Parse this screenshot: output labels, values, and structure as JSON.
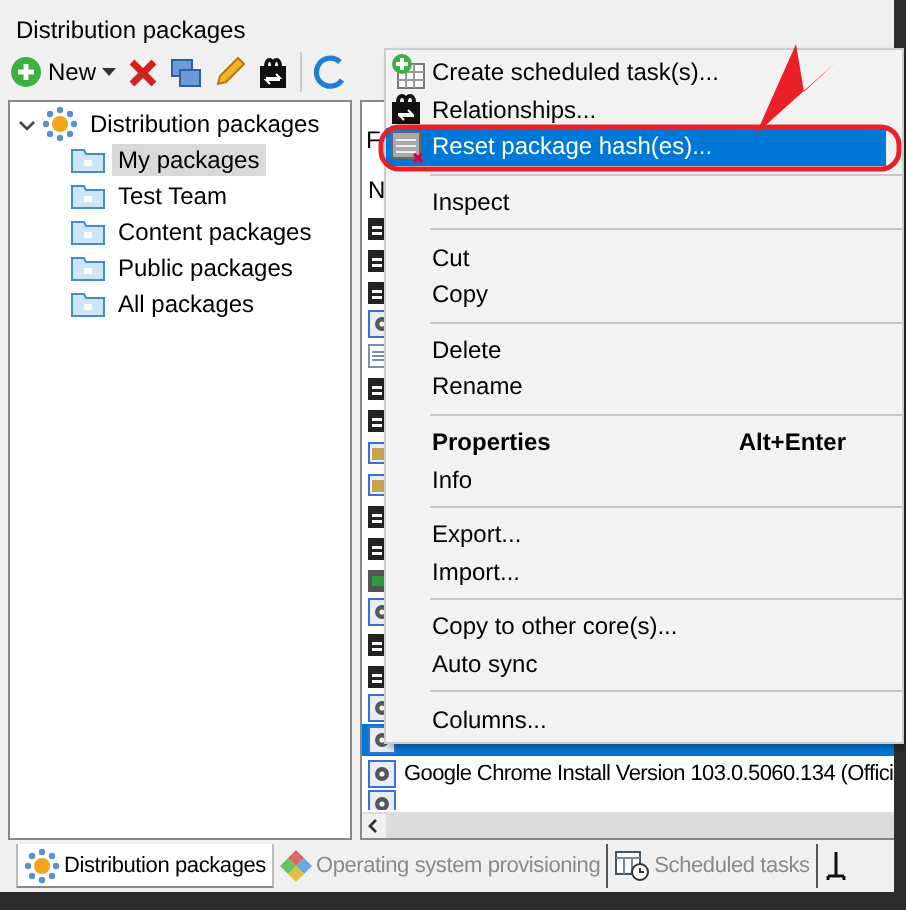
{
  "window": {
    "title": "Distribution packages"
  },
  "toolbar": {
    "new_button": {
      "label": "New"
    }
  },
  "tree": {
    "label": "Distribution packages",
    "expanded": true,
    "children": [
      {
        "label": "My packages",
        "selected": true
      },
      {
        "label": "Test Team",
        "selected": false
      },
      {
        "label": "Content packages",
        "selected": false
      },
      {
        "label": "Public packages",
        "selected": false
      },
      {
        "label": "All packages",
        "selected": false
      }
    ]
  },
  "list": {
    "filter_label": "F",
    "column_1": "N",
    "rows": [
      {
        "name": "Google Chrome Install Version 103.0.5060.134 (Offici",
        "selected": false
      }
    ]
  },
  "context_menu": {
    "items": [
      {
        "kind": "item",
        "label": "Create scheduled task(s)...",
        "selected": false,
        "bold": false
      },
      {
        "kind": "item",
        "label": "Relationships...",
        "selected": false,
        "bold": false
      },
      {
        "kind": "item",
        "label": "Reset package hash(es)...",
        "selected": true,
        "bold": false
      },
      {
        "kind": "separator"
      },
      {
        "kind": "item",
        "label": "Inspect",
        "selected": false,
        "bold": false
      },
      {
        "kind": "separator"
      },
      {
        "kind": "item",
        "label": "Cut",
        "selected": false,
        "bold": false
      },
      {
        "kind": "item",
        "label": "Copy",
        "selected": false,
        "bold": false
      },
      {
        "kind": "separator"
      },
      {
        "kind": "item",
        "label": "Delete",
        "selected": false,
        "bold": false
      },
      {
        "kind": "item",
        "label": "Rename",
        "selected": false,
        "bold": false
      },
      {
        "kind": "separator"
      },
      {
        "kind": "item",
        "label": "Properties",
        "shortcut": "Alt+Enter",
        "selected": false,
        "bold": true
      },
      {
        "kind": "item",
        "label": "Info",
        "selected": false,
        "bold": false
      },
      {
        "kind": "separator"
      },
      {
        "kind": "item",
        "label": "Export...",
        "selected": false,
        "bold": false
      },
      {
        "kind": "item",
        "label": "Import...",
        "selected": false,
        "bold": false
      },
      {
        "kind": "separator"
      },
      {
        "kind": "item",
        "label": "Copy to other core(s)...",
        "selected": false,
        "bold": false
      },
      {
        "kind": "item",
        "label": "Auto sync",
        "selected": false,
        "bold": false
      },
      {
        "kind": "separator"
      },
      {
        "kind": "item",
        "label": "Columns...",
        "selected": false,
        "bold": false
      }
    ]
  },
  "bottom_tabs": [
    {
      "label": "Distribution packages",
      "selected": true
    },
    {
      "label": "Operating system provisioning",
      "selected": false
    },
    {
      "label": "Scheduled tasks",
      "selected": false
    }
  ]
}
